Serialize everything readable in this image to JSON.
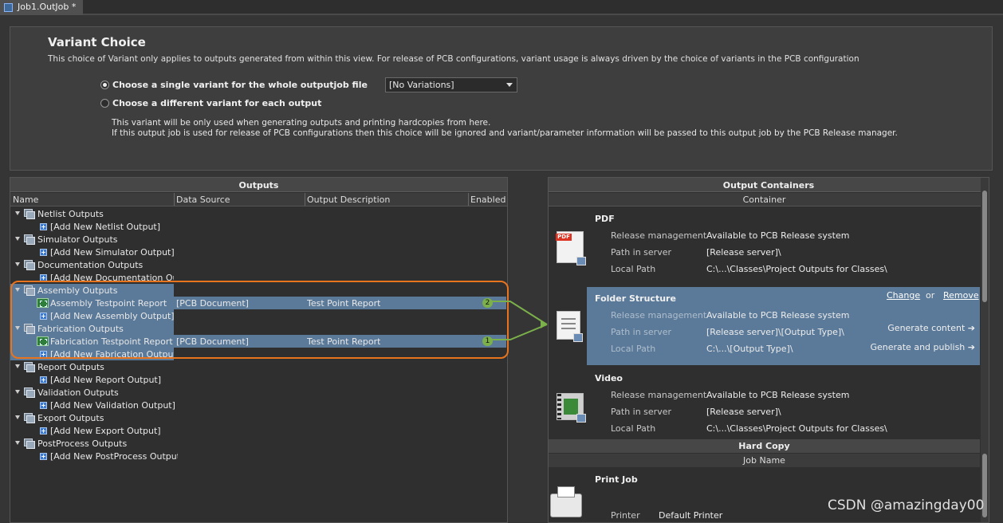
{
  "tab": {
    "title": "Job1.OutJob *"
  },
  "variant": {
    "title": "Variant Choice",
    "description": "This choice of Variant only applies to outputs generated from within this view. For release of PCB configurations, variant usage is always driven by the choice of variants in the PCB configuration",
    "option_single": "Choose a single variant for the whole outputjob file",
    "option_different": "Choose a different variant for each output",
    "selected_variant": "[No Variations]",
    "note_line1": "This variant will be only used when generating outputs and printing hardcopies from here.",
    "note_line2": "If this output job is used for release of PCB configurations then this choice will be ignored and variant/parameter information will be passed to this output job by the PCB Release manager."
  },
  "outputs": {
    "title": "Outputs",
    "columns": {
      "name": "Name",
      "source": "Data Source",
      "description": "Output Description",
      "enabled": "Enabled"
    },
    "groups": [
      {
        "name": "Netlist Outputs",
        "add": "[Add New Netlist Output]"
      },
      {
        "name": "Simulator Outputs",
        "add": "[Add New Simulator Output]"
      },
      {
        "name": "Documentation Outputs",
        "add": "[Add New Documentation Output]"
      },
      {
        "name": "Assembly Outputs",
        "add": "[Add New Assembly Output]",
        "item": {
          "name": "Assembly Testpoint Report",
          "source": "[PCB Document]",
          "description": "Test Point Report",
          "enabled": "2"
        }
      },
      {
        "name": "Fabrication Outputs",
        "add": "[Add New Fabrication Output]",
        "item": {
          "name": "Fabrication Testpoint Report",
          "source": "[PCB Document]",
          "description": "Test Point Report",
          "enabled": "1"
        }
      },
      {
        "name": "Report Outputs",
        "add": "[Add New Report Output]"
      },
      {
        "name": "Validation Outputs",
        "add": "[Add New Validation Output]"
      },
      {
        "name": "Export Outputs",
        "add": "[Add New Export Output]"
      },
      {
        "name": "PostProcess Outputs",
        "add": "[Add New PostProcess Output]"
      }
    ]
  },
  "containers": {
    "title": "Output Containers",
    "column": "Container",
    "labels": {
      "release": "Release management",
      "path": "Path in server",
      "local": "Local Path"
    },
    "items": [
      {
        "name": "PDF",
        "release": "Available to PCB Release system",
        "path": "[Release server]\\",
        "local": "C:\\...\\Classes\\Project Outputs for Classes\\"
      },
      {
        "name": "Folder Structure",
        "release": "Available to PCB Release system",
        "path": "[Release server]\\[Output Type]\\",
        "local": "C:\\...\\[Output Type]\\",
        "change": "Change",
        "or": "or",
        "remove": "Remove",
        "generate_content": "Generate content",
        "generate_publish": "Generate and publish"
      },
      {
        "name": "Video",
        "release": "Available to PCB Release system",
        "path": "[Release server]\\",
        "local": "C:\\...\\Classes\\Project Outputs for Classes\\"
      }
    ],
    "hardcopy": {
      "title": "Hard Copy",
      "column": "Job Name",
      "job": "Print Job",
      "printer_label": "Printer",
      "printer": "Default Printer"
    }
  },
  "watermark": "CSDN @amazingday00"
}
